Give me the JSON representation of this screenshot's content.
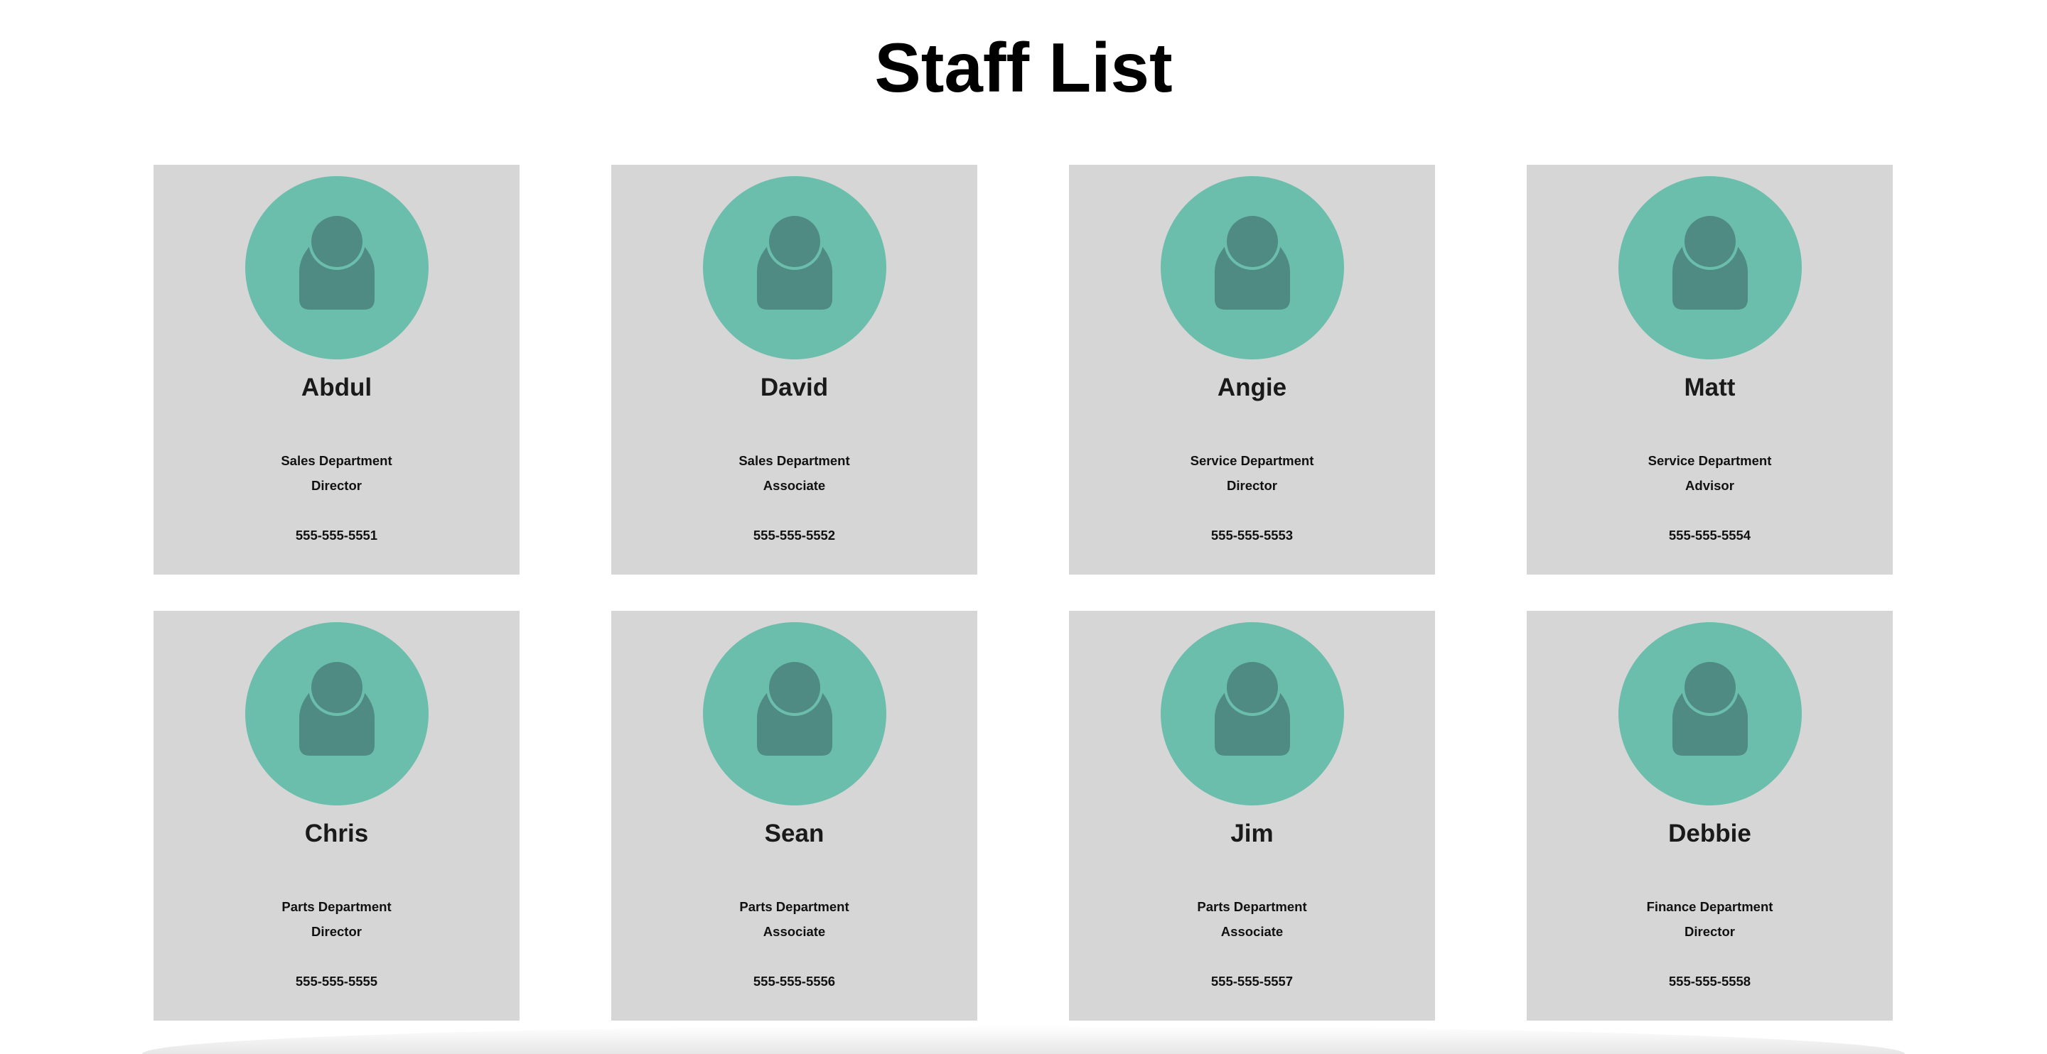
{
  "page": {
    "title": "Staff List"
  },
  "colors": {
    "card_background": "#d6d6d6",
    "avatar_background": "#6abeab",
    "avatar_figure": "#4f8a83"
  },
  "staff": [
    {
      "name": "Abdul",
      "department": "Sales Department",
      "role": "Director",
      "phone": "555-555-5551",
      "icon": "person-icon"
    },
    {
      "name": "David",
      "department": "Sales Department",
      "role": "Associate",
      "phone": "555-555-5552",
      "icon": "person-icon"
    },
    {
      "name": "Angie",
      "department": "Service Department",
      "role": "Director",
      "phone": "555-555-5553",
      "icon": "person-icon"
    },
    {
      "name": "Matt",
      "department": "Service Department",
      "role": "Advisor",
      "phone": "555-555-5554",
      "icon": "person-icon"
    },
    {
      "name": "Chris",
      "department": "Parts Department",
      "role": "Director",
      "phone": "555-555-5555",
      "icon": "person-icon"
    },
    {
      "name": "Sean",
      "department": "Parts Department",
      "role": "Associate",
      "phone": "555-555-5556",
      "icon": "person-icon"
    },
    {
      "name": "Jim",
      "department": "Parts Department",
      "role": "Associate",
      "phone": "555-555-5557",
      "icon": "person-icon"
    },
    {
      "name": "Debbie",
      "department": "Finance Department",
      "role": "Director",
      "phone": "555-555-5558",
      "icon": "person-icon"
    }
  ]
}
